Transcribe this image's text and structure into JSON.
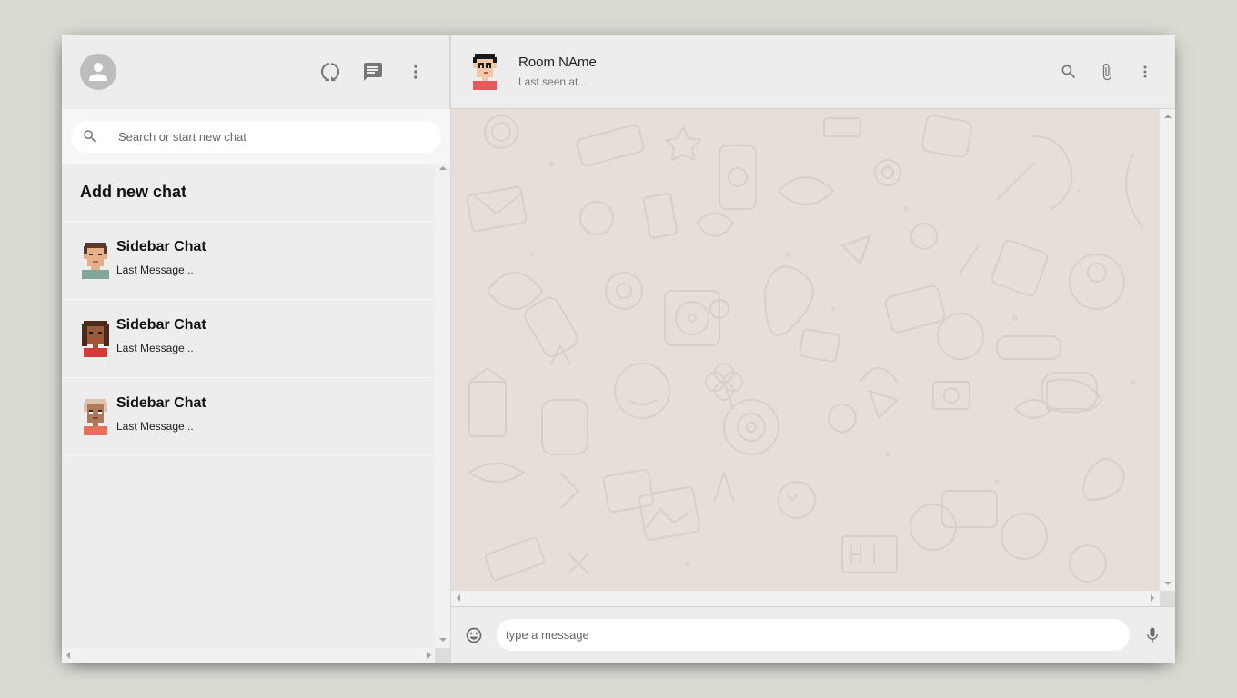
{
  "sidebar": {
    "header_icons": [
      "status-icon",
      "chat-icon",
      "more-vert-icon"
    ],
    "search": {
      "placeholder": "Search or start new chat"
    },
    "add_new_chat_label": "Add new chat",
    "chats": [
      {
        "name": "Sidebar Chat",
        "last_message": "Last Message...",
        "avatar": "pixel-avatar-1"
      },
      {
        "name": "Sidebar Chat",
        "last_message": "Last Message...",
        "avatar": "pixel-avatar-2"
      },
      {
        "name": "Sidebar Chat",
        "last_message": "Last Message...",
        "avatar": "pixel-avatar-3"
      }
    ]
  },
  "chat": {
    "room_name": "Room NAme",
    "last_seen": "Last seen at...",
    "header_icons": [
      "search-icon",
      "attach-icon",
      "more-vert-icon"
    ],
    "message_placeholder": "type a message",
    "footer_icons": [
      "emoji-icon",
      "mic-icon"
    ]
  },
  "colors": {
    "page_bg": "#dadbd3",
    "panel_bg": "#ededed",
    "chat_bg": "#e6dfd9"
  }
}
